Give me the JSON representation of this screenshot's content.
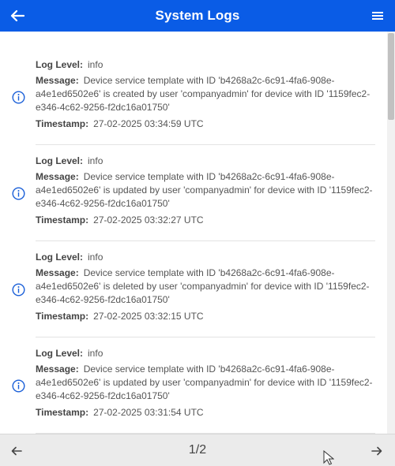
{
  "header": {
    "title": "System Logs",
    "back_icon": "arrow-left-icon",
    "menu_icon": "hamburger-menu-icon",
    "color": "#0a5ce6"
  },
  "labels": {
    "log_level": "Log Level:",
    "message": "Message:",
    "timestamp": "Timestamp:"
  },
  "logs": [
    {
      "level": "info",
      "message": "Device service template with ID 'b4268a2c-6c91-4fa6-908e-a4e1ed6502e6' is created by user 'companyadmin' for device with ID '1159fec2-e346-4c62-9256-f2dc16a01750'",
      "timestamp": "27-02-2025 03:34:59 UTC"
    },
    {
      "level": "info",
      "message": "Device service template with ID 'b4268a2c-6c91-4fa6-908e-a4e1ed6502e6' is updated by user 'companyadmin' for device with ID '1159fec2-e346-4c62-9256-f2dc16a01750'",
      "timestamp": "27-02-2025 03:32:27 UTC"
    },
    {
      "level": "info",
      "message": "Device service template with ID 'b4268a2c-6c91-4fa6-908e-a4e1ed6502e6' is deleted by user 'companyadmin' for device with ID '1159fec2-e346-4c62-9256-f2dc16a01750'",
      "timestamp": "27-02-2025 03:32:15 UTC"
    },
    {
      "level": "info",
      "message": "Device service template with ID 'b4268a2c-6c91-4fa6-908e-a4e1ed6502e6' is updated by user 'companyadmin' for device with ID '1159fec2-e346-4c62-9256-f2dc16a01750'",
      "timestamp": "27-02-2025 03:31:54 UTC"
    }
  ],
  "pagination": {
    "page_text": "1/2",
    "prev_icon": "arrow-left-icon",
    "next_icon": "arrow-right-icon"
  }
}
